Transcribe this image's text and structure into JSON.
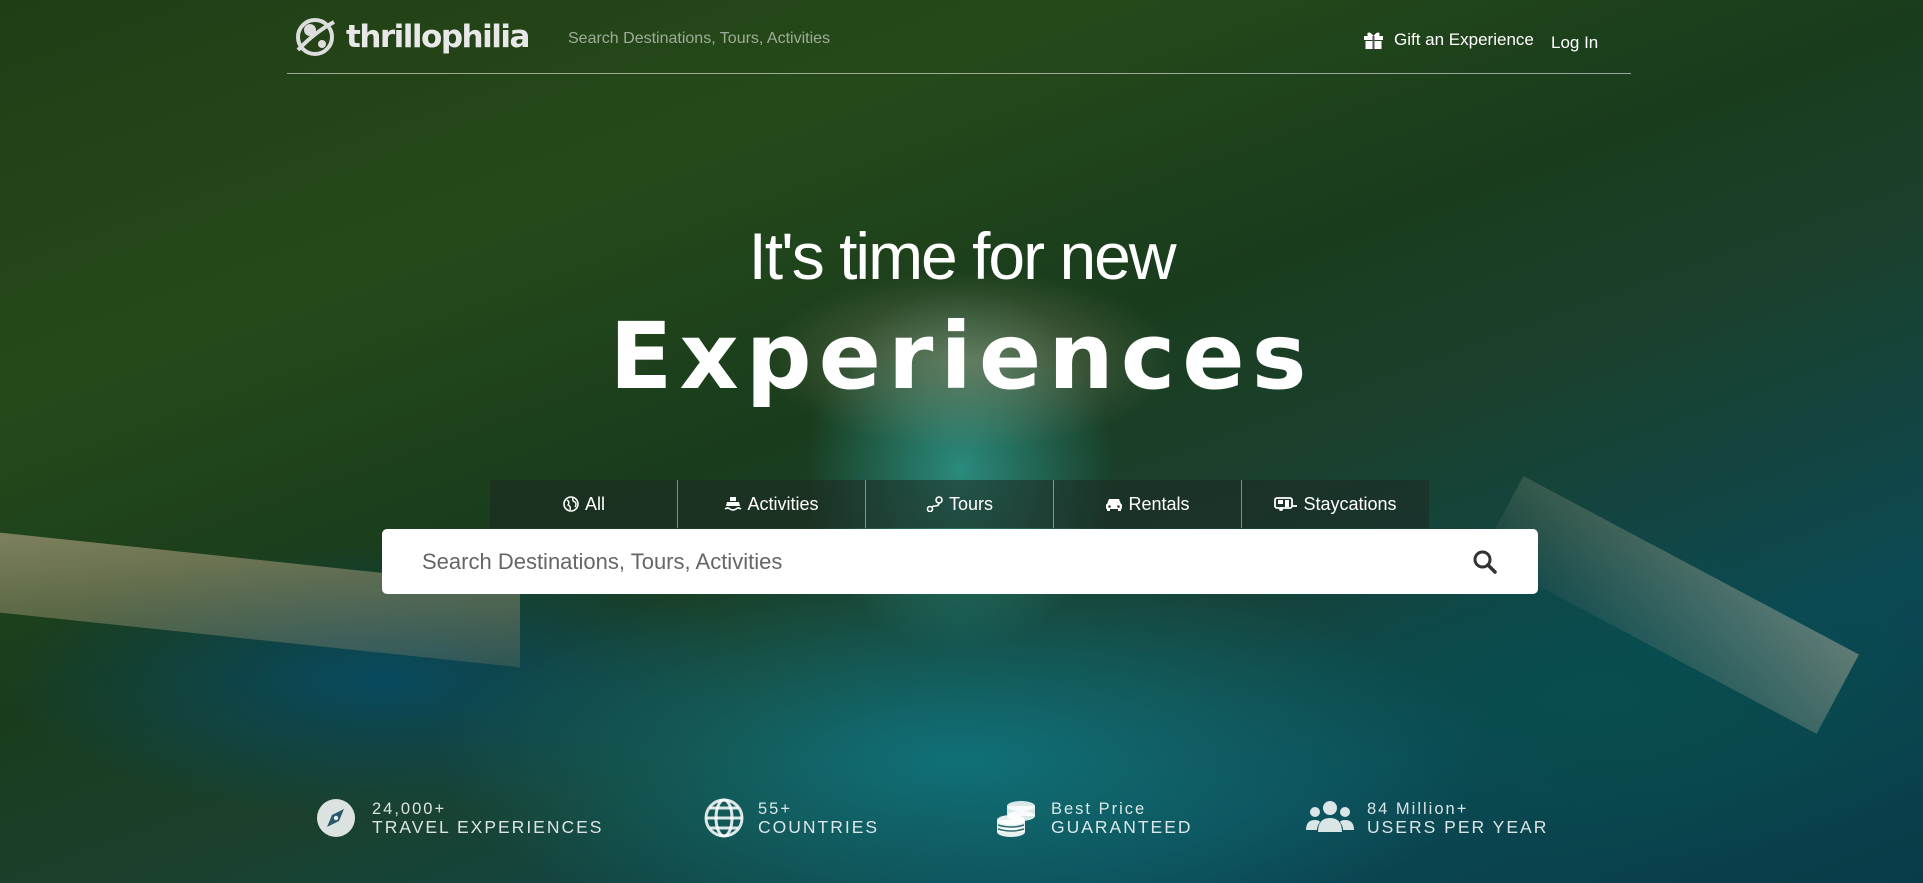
{
  "brand": {
    "name": "thrillophilia"
  },
  "header": {
    "search_placeholder": "Search Destinations, Tours, Activities",
    "gift_label": "Gift an Experience",
    "login_label": "Log In"
  },
  "hero": {
    "line1": "It's time for new",
    "line2": "Experiences"
  },
  "tabs": [
    {
      "label": "All",
      "icon": "globe-icon"
    },
    {
      "label": "Activities",
      "icon": "boat-icon"
    },
    {
      "label": "Tours",
      "icon": "route-icon"
    },
    {
      "label": "Rentals",
      "icon": "car-icon"
    },
    {
      "label": "Staycations",
      "icon": "caravan-icon"
    }
  ],
  "search": {
    "placeholder": "Search Destinations, Tours, Activities"
  },
  "stats": [
    {
      "value": "24,000+",
      "label": "TRAVEL EXPERIENCES",
      "icon": "compass-icon"
    },
    {
      "value": "55+",
      "label": "COUNTRIES",
      "icon": "globe-icon"
    },
    {
      "value": "Best Price",
      "label": "GUARANTEED",
      "icon": "coins-icon"
    },
    {
      "value": "84 Million+",
      "label": "USERS PER YEAR",
      "icon": "users-icon"
    }
  ]
}
